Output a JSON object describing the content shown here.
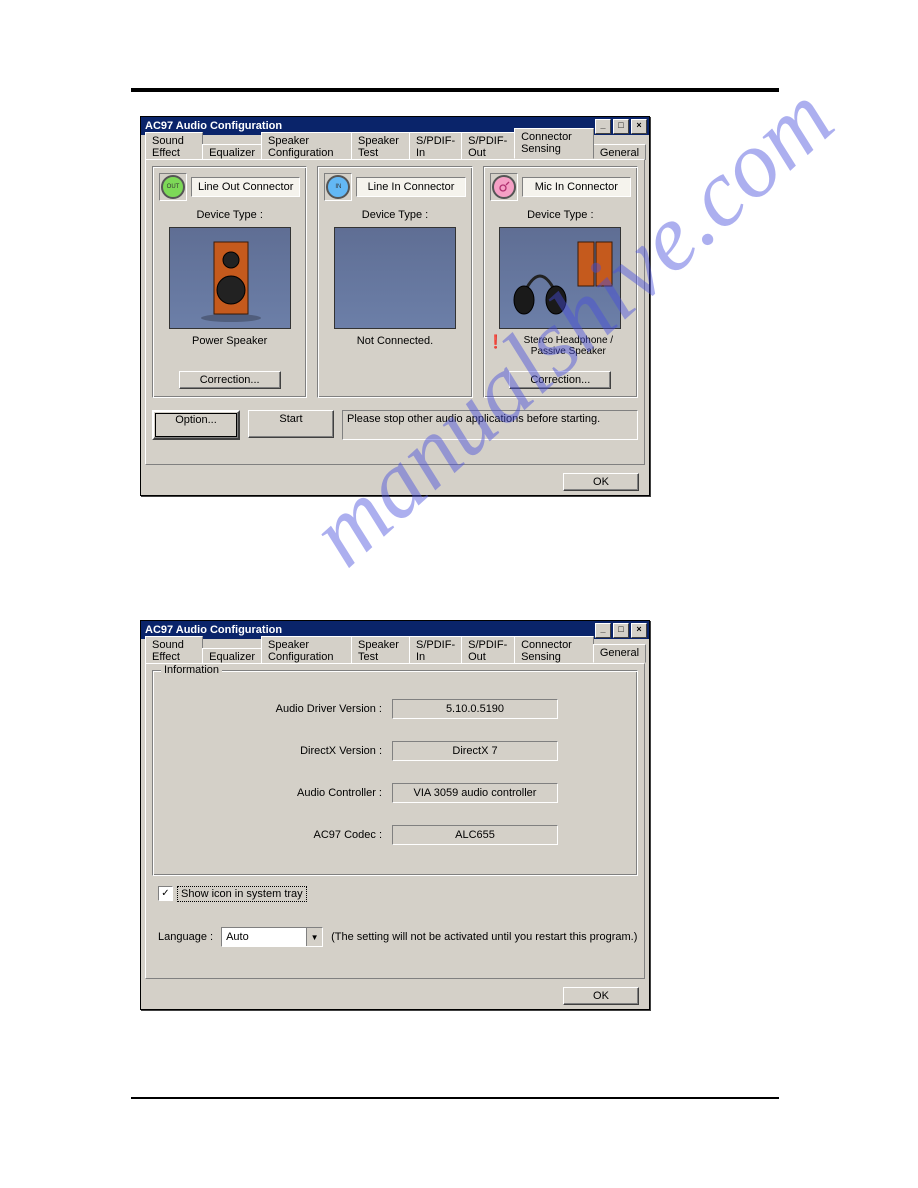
{
  "watermark": "manualshive.com",
  "window1": {
    "title": "AC97 Audio Configuration",
    "tabs": [
      "Sound Effect",
      "Equalizer",
      "Speaker Configuration",
      "Speaker Test",
      "S/PDIF-In",
      "S/PDIF-Out",
      "Connector Sensing",
      "General"
    ],
    "active_tab": "Connector Sensing",
    "cards": [
      {
        "jack_color": "green",
        "jack_text": "OUT",
        "connector": "Line Out Connector",
        "device_type_label": "Device Type :",
        "device_name": "Power Speaker",
        "correction": "Correction...",
        "show_correction": true,
        "show_warn": false,
        "image": "speaker"
      },
      {
        "jack_color": "blue",
        "jack_text": "IN",
        "connector": "Line In Connector",
        "device_type_label": "Device Type :",
        "device_name": "Not Connected.",
        "correction": "",
        "show_correction": false,
        "show_warn": false,
        "image": "none"
      },
      {
        "jack_color": "pink",
        "jack_text": "",
        "connector": "Mic In Connector",
        "device_type_label": "Device Type :",
        "device_name": "Stereo Headphone / Passive Speaker",
        "correction": "Correction...",
        "show_correction": true,
        "show_warn": true,
        "image": "headphone"
      }
    ],
    "option_btn": "Option...",
    "start_btn": "Start",
    "message": "Please stop other audio applications before starting.",
    "ok_btn": "OK"
  },
  "window2": {
    "title": "AC97 Audio Configuration",
    "tabs": [
      "Sound Effect",
      "Equalizer",
      "Speaker Configuration",
      "Speaker Test",
      "S/PDIF-In",
      "S/PDIF-Out",
      "Connector Sensing",
      "General"
    ],
    "active_tab": "General",
    "group_label": "Information",
    "rows": [
      {
        "label": "Audio Driver Version :",
        "value": "5.10.0.5190"
      },
      {
        "label": "DirectX Version :",
        "value": "DirectX 7"
      },
      {
        "label": "Audio Controller :",
        "value": "VIA 3059 audio controller"
      },
      {
        "label": "AC97 Codec :",
        "value": "ALC655"
      }
    ],
    "checkbox_label": "Show icon in system tray",
    "checkbox_checked": true,
    "language_label": "Language :",
    "language_value": "Auto",
    "language_note": "(The setting will not be activated until you restart this program.)",
    "ok_btn": "OK"
  }
}
